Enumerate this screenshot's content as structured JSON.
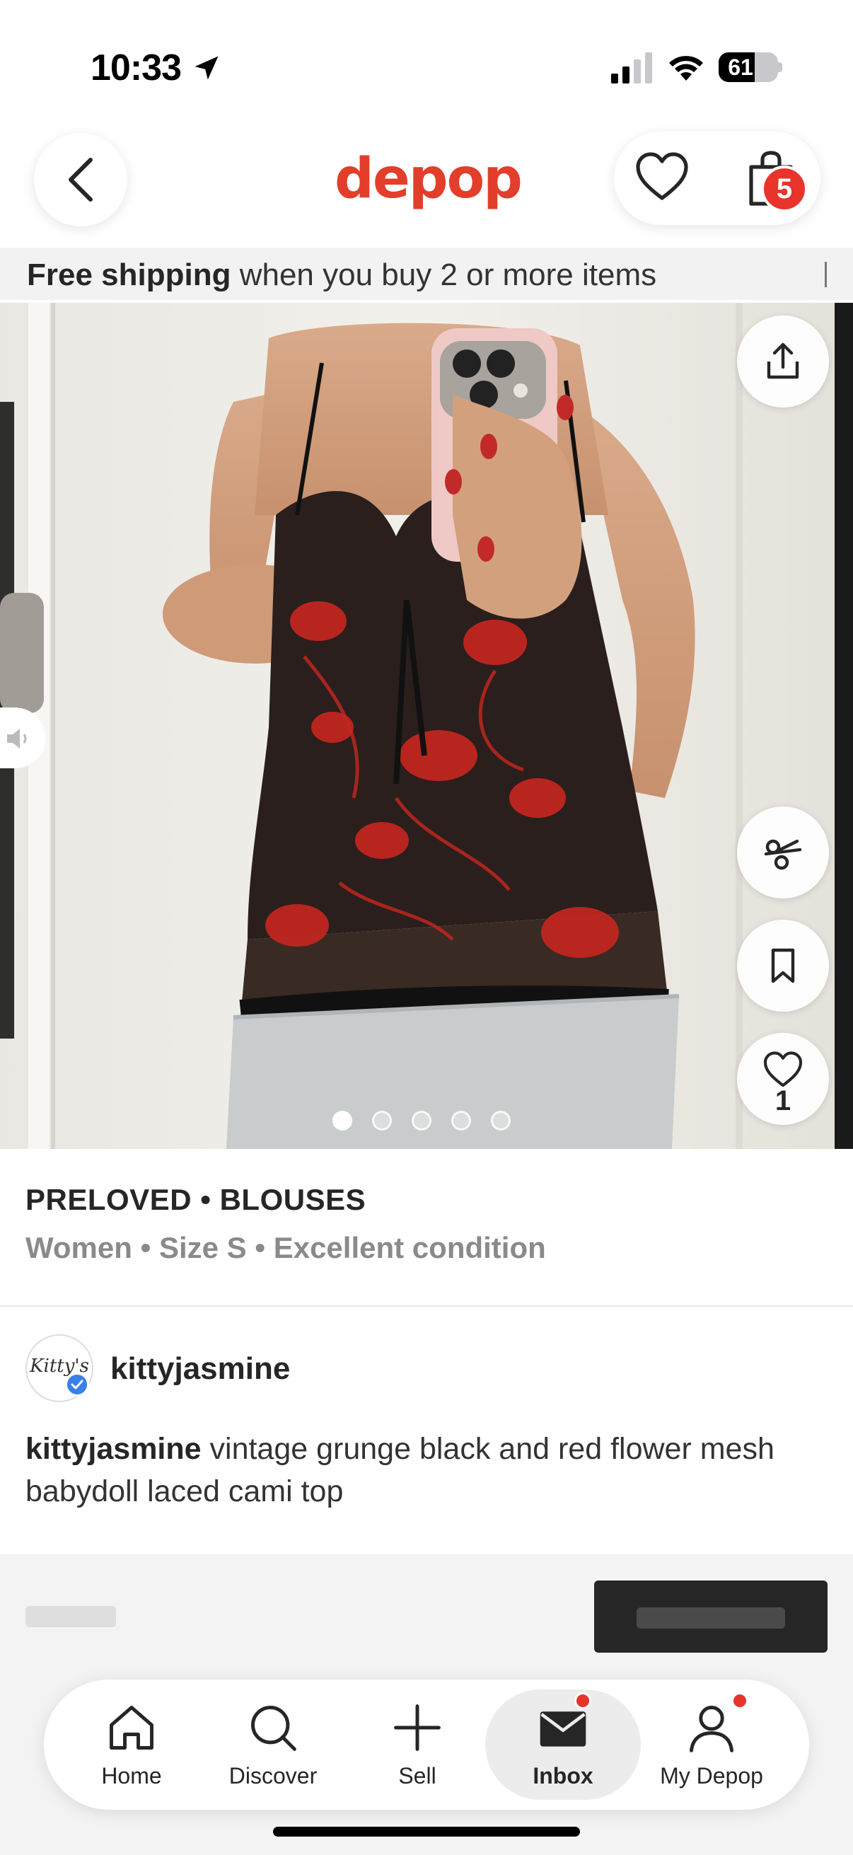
{
  "status_bar": {
    "time": "10:33",
    "battery": "61",
    "battery_level": 0.61
  },
  "header": {
    "logo": "depop",
    "bag_count": "5"
  },
  "promo": {
    "bold": "Free shipping",
    "rest": " when you buy 2 or more items"
  },
  "gallery": {
    "image_count": 5,
    "active_index": 0,
    "like_count": "1"
  },
  "product": {
    "category": "PRELOVED • BLOUSES",
    "attributes": "Women • Size S • Excellent condition"
  },
  "seller": {
    "username": "kittyjasmine",
    "avatar_text": "Kitty's",
    "verified": true
  },
  "description": {
    "username": "kittyjasmine",
    "text": " vintage grunge black and red flower mesh babydoll laced cami top"
  },
  "tab_bar": {
    "items": [
      {
        "label": "Home",
        "icon": "home-icon"
      },
      {
        "label": "Discover",
        "icon": "search-icon"
      },
      {
        "label": "Sell",
        "icon": "plus-icon"
      },
      {
        "label": "Inbox",
        "icon": "mail-icon",
        "active": true,
        "notification": true
      },
      {
        "label": "My Depop",
        "icon": "person-icon",
        "notification": true
      }
    ]
  },
  "colors": {
    "brand": "#e23e2b",
    "badge": "#e8342a",
    "verified": "#3a7ee8"
  }
}
